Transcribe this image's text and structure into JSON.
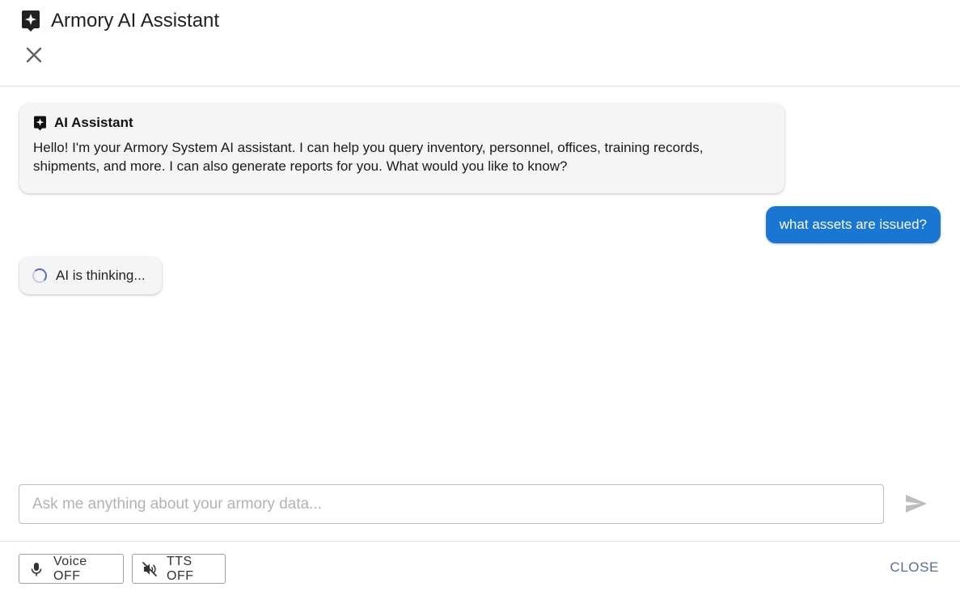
{
  "header": {
    "title": "Armory AI Assistant",
    "title_icon": "ai-sparkle-icon",
    "close_icon": "close-icon"
  },
  "messages": [
    {
      "role": "assistant",
      "sender": "AI Assistant",
      "text": "Hello! I'm your Armory System AI assistant. I can help you query inventory, personnel, offices, training records, shipments, and more. I can also generate reports for you. What would you like to know?"
    },
    {
      "role": "user",
      "text": "what assets are issued?"
    }
  ],
  "thinking": {
    "label": "AI is thinking..."
  },
  "input": {
    "value": "",
    "placeholder": "Ask me anything about your armory data..."
  },
  "footer": {
    "voice_label": "Voice OFF",
    "tts_label": "TTS OFF",
    "close_label": "CLOSE"
  },
  "colors": {
    "user_bubble": "#1976d2",
    "ai_bubble": "#f5f5f5",
    "close_text": "#5a6d94",
    "spinner": "#5c6bc0"
  }
}
